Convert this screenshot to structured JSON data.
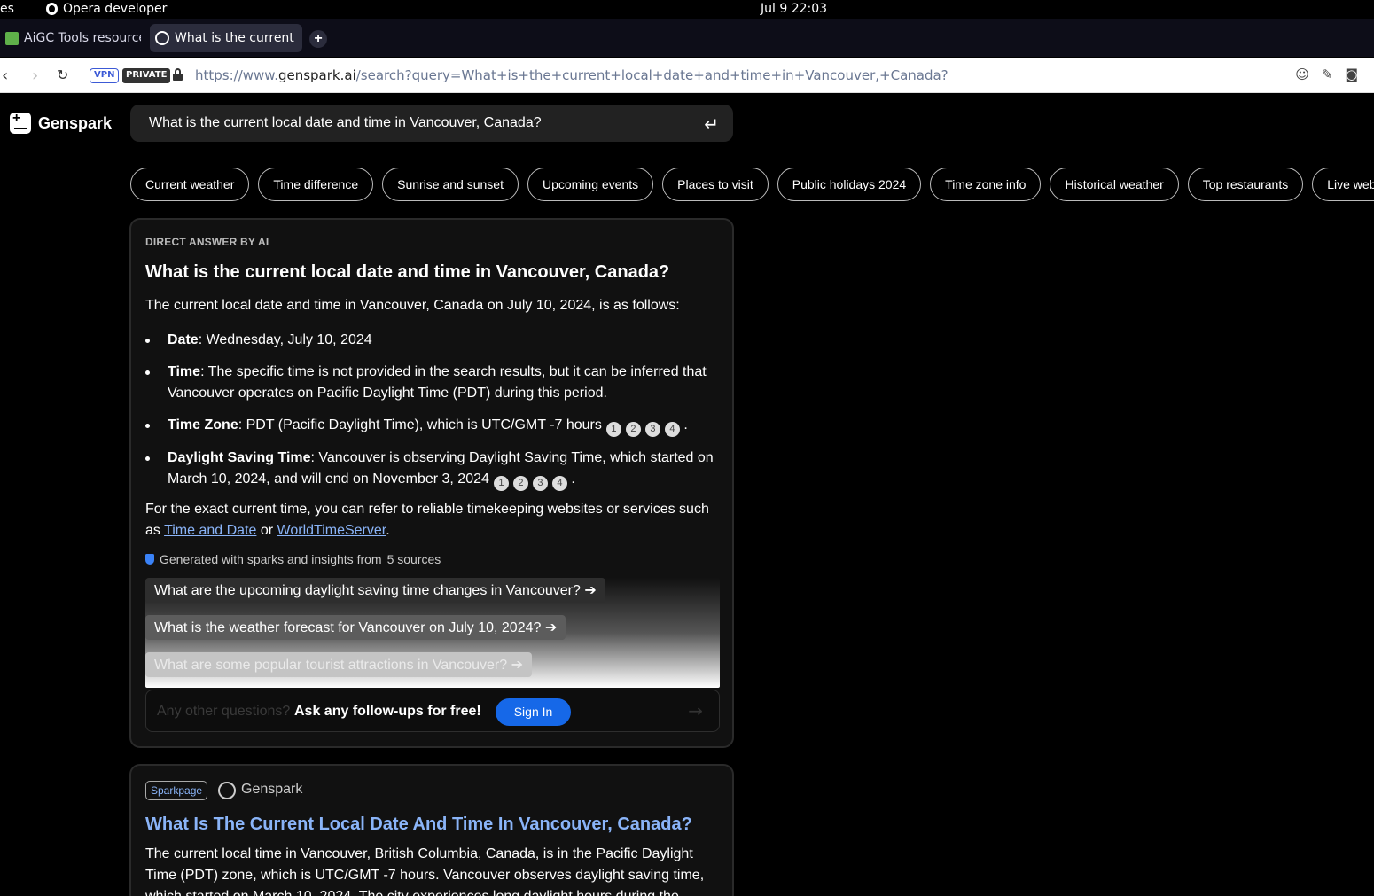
{
  "os": {
    "left_fragment": "es",
    "app_name": "Opera developer",
    "clock": "Jul 9  22:03"
  },
  "tabs": [
    {
      "label": "AiGC Tools resources"
    },
    {
      "label": "What is the current lo"
    }
  ],
  "address_bar": {
    "vpn": "VPN",
    "private": "PRIVATE",
    "url_scheme": "https://www.",
    "url_host": "genspark.ai",
    "url_path": "/search?query=What+is+the+current+local+date+and+time+in+Vancouver,+Canada?"
  },
  "brand": {
    "name": "Genspark"
  },
  "search": {
    "query": "What is the current local date and time in Vancouver, Canada?"
  },
  "chips": [
    "Current weather",
    "Time difference",
    "Sunrise and sunset",
    "Upcoming events",
    "Places to visit",
    "Public holidays 2024",
    "Time zone info",
    "Historical weather",
    "Top restaurants",
    "Live web"
  ],
  "answer": {
    "label": "DIRECT ANSWER BY AI",
    "title": "What is the current local date and time in Vancouver, Canada?",
    "intro": "The current local date and time in Vancouver, Canada on July 10, 2024, is as follows:",
    "bullets": [
      {
        "term": "Date",
        "text": ": Wednesday, July 10, 2024"
      },
      {
        "term": "Time",
        "text": ": The specific time is not provided in the search results, but it can be inferred that Vancouver operates on Pacific Daylight Time (PDT) during this period."
      },
      {
        "term": "Time Zone",
        "text": ": PDT (Pacific Daylight Time), which is UTC/GMT -7 hours"
      },
      {
        "term": "Daylight Saving Time",
        "text": ": Vancouver is observing Daylight Saving Time, which started on March 10, 2024, and will end on November 3, 2024"
      }
    ],
    "citations": [
      "1",
      "2",
      "3",
      "4"
    ],
    "period": ".",
    "closing_pre": "For the exact current time, you can refer to reliable timekeeping websites or services such as ",
    "link1": "Time and Date",
    "closing_mid": " or ",
    "link2": "WorldTimeServer",
    "closing_end": ".",
    "generated_text": "Generated with sparks and insights from",
    "sources_link": "5 sources",
    "followups": [
      "What are the upcoming daylight saving time changes in Vancouver? ➔",
      "What is the weather forecast for Vancouver on July 10, 2024? ➔",
      "What are some popular tourist attractions in Vancouver? ➔"
    ],
    "ask_placeholder": "Any other questions?",
    "ask_free": "Ask any follow-ups for free!",
    "signin": "Sign In"
  },
  "sparkpage": {
    "tag": "Sparkpage",
    "source": "Genspark",
    "title": "What Is The Current Local Date And Time In Vancouver, Canada?",
    "body": "The current local time in Vancouver, British Columbia, Canada, is in the Pacific Daylight Time (PDT) zone, which is UTC/GMT -7 hours. Vancouver observes daylight saving time, which started on March 10, 2024. The city experiences long daylight hours during the"
  }
}
